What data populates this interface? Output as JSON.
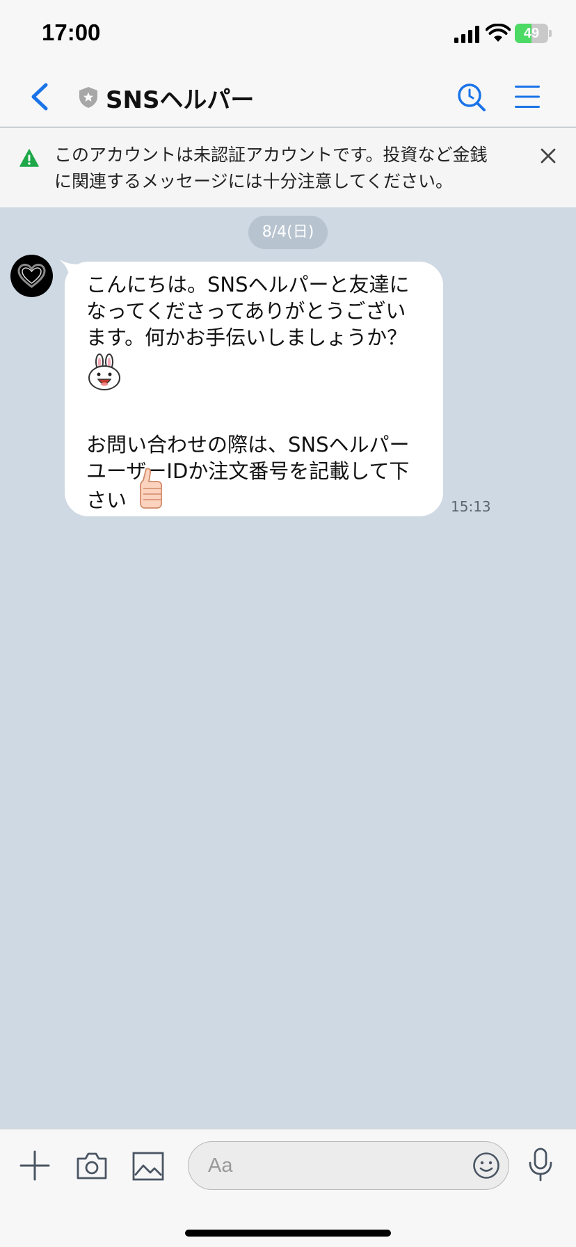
{
  "status_bar": {
    "time": "17:00",
    "battery_percent": "49",
    "battery_level": 0.49
  },
  "header": {
    "title": "SNSヘルパー",
    "icons": [
      "back-icon",
      "shield-star-icon",
      "search-icon",
      "menu-icon"
    ]
  },
  "warning": {
    "text": "このアカウントは未認証アカウントです。投資など金銭に関連するメッセージには十分注意してください。",
    "lines": [
      "このアカウントは未認証アカウントです。投資など金銭",
      "に関連するメッセージには十分注意してください。"
    ],
    "icon": "warning-icon",
    "close_icon": "close-icon"
  },
  "chat": {
    "date": "8/4(日)",
    "messages": [
      {
        "sender_avatar": "heart-avatar",
        "lines_before_emoji": [
          "こんにちは。SNSヘルパーと友達に",
          "なってくださってありがとうござい",
          "ます。何かお手伝いしましょうか？"
        ],
        "emoji_1": "rabbit-emoji",
        "lines_after_emoji": [
          "お問い合わせの際は、SNSヘルパー",
          "ユーザーIDか注文番号を記載して下",
          "さい"
        ],
        "emoji_2": "thumbs-up-emoji",
        "time": "15:13"
      }
    ]
  },
  "input_bar": {
    "placeholder": "Aa",
    "icons": [
      "plus-icon",
      "camera-icon",
      "image-icon",
      "smiley-icon",
      "microphone-icon"
    ]
  },
  "colors": {
    "accent_blue": "#1a73e8",
    "chat_background": "#cfd9e3",
    "warning_green": "#1fa84a",
    "battery_green": "#4cd964"
  }
}
